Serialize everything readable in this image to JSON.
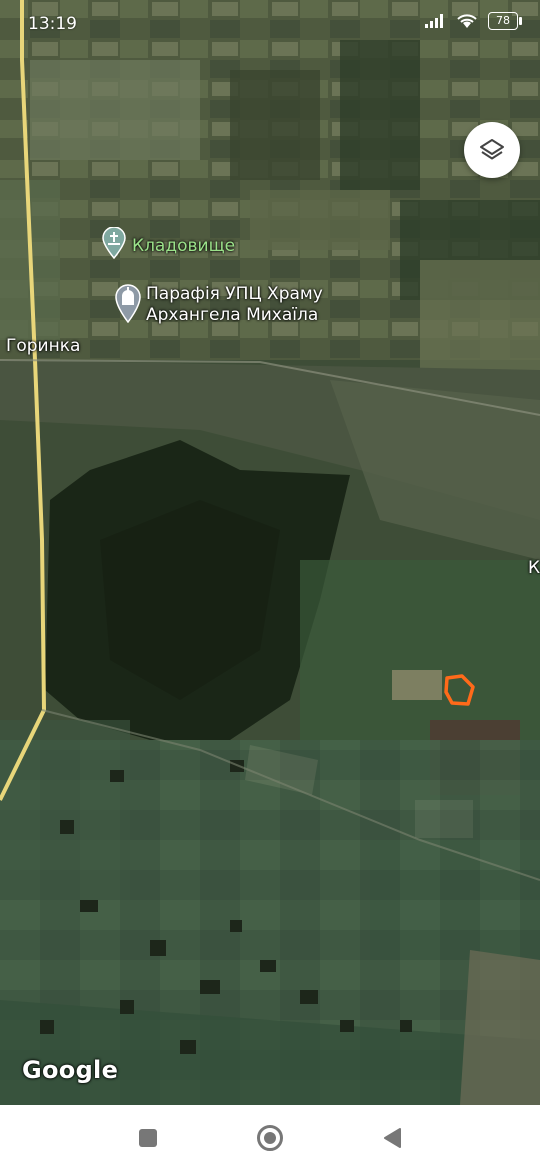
{
  "status_bar": {
    "time": "13:19",
    "battery": "78"
  },
  "map": {
    "labels": {
      "cemetery": "Кладовище",
      "church_line1": "Парафія УПЦ Храму",
      "church_line2": "Архангела Михаїла",
      "village": "Горинка",
      "edge_letter": "К"
    },
    "attribution": "Google"
  },
  "controls": {
    "layers_icon": "layers-icon"
  },
  "nav_bar": {
    "icons": [
      "recents-square-icon",
      "home-circle-icon",
      "back-triangle-icon"
    ]
  },
  "colors": {
    "marker_outline": "#ff6a1a",
    "road": "#e8d67a"
  }
}
